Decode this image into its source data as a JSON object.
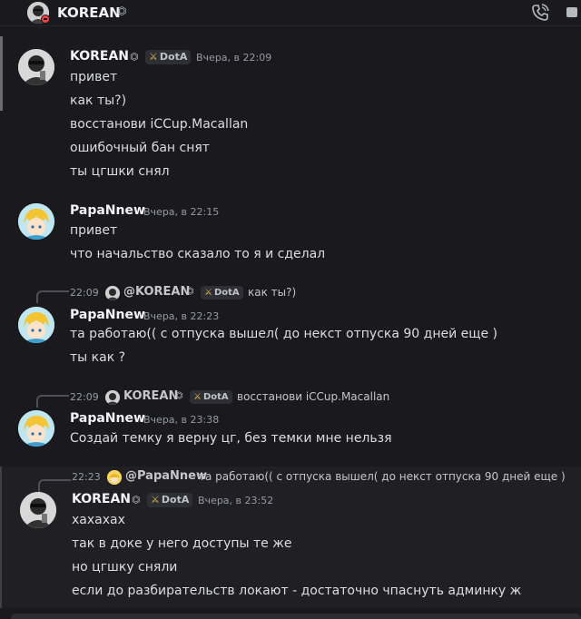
{
  "header": {
    "title": "KOREAN",
    "badge_icon": "shield-icon",
    "call_icon": "phone-call-icon"
  },
  "colors": {
    "background": "#1a1a1e",
    "dnd_status": "#f23f43",
    "timestamp": "#949ba4"
  },
  "messages": [
    {
      "author": "KOREAN",
      "tag": "DotA",
      "time": "Вчера, в 22:09",
      "lines": [
        "привет",
        "как ты?)",
        "восстанови iCCup.Macallan",
        "ошибочный бан снят",
        "ты цгшки снял"
      ]
    },
    {
      "author": "PapaNnew",
      "time": "Вчера, в 22:15",
      "lines": [
        "привет",
        "что начальство сказало то я и сделал"
      ]
    },
    {
      "reply": {
        "time": "22:09",
        "author": "@KOREAN",
        "tag": "DotA",
        "text": "как ты?)"
      },
      "author": "PapaNnew",
      "time": "Вчера, в 22:23",
      "lines": [
        "та работаю(( с отпуска вышел( до некст отпуска 90 дней еще )",
        "ты как ?"
      ]
    },
    {
      "reply": {
        "time": "22:09",
        "author": "KOREAN",
        "tag": "DotA",
        "text": "восстанови iCCup.Macallan"
      },
      "author": "PapaNnew",
      "time": "Вчера, в 23:38",
      "lines": [
        "Создай темку я верну цг, без темки мне нельзя"
      ]
    },
    {
      "reply": {
        "time": "22:23",
        "author": "@PapaNnew",
        "text": "та работаю(( с отпуска вышел( до некст отпуска 90 дней еще )"
      },
      "author": "KOREAN",
      "tag": "DotA",
      "time": "Вчера, в 23:52",
      "lines": [
        "хахахах",
        "так в доке у него доступы те же",
        "но цгшку сняли",
        "если до разбирательств локают - достаточно чпаснуть админку ж"
      ]
    }
  ]
}
